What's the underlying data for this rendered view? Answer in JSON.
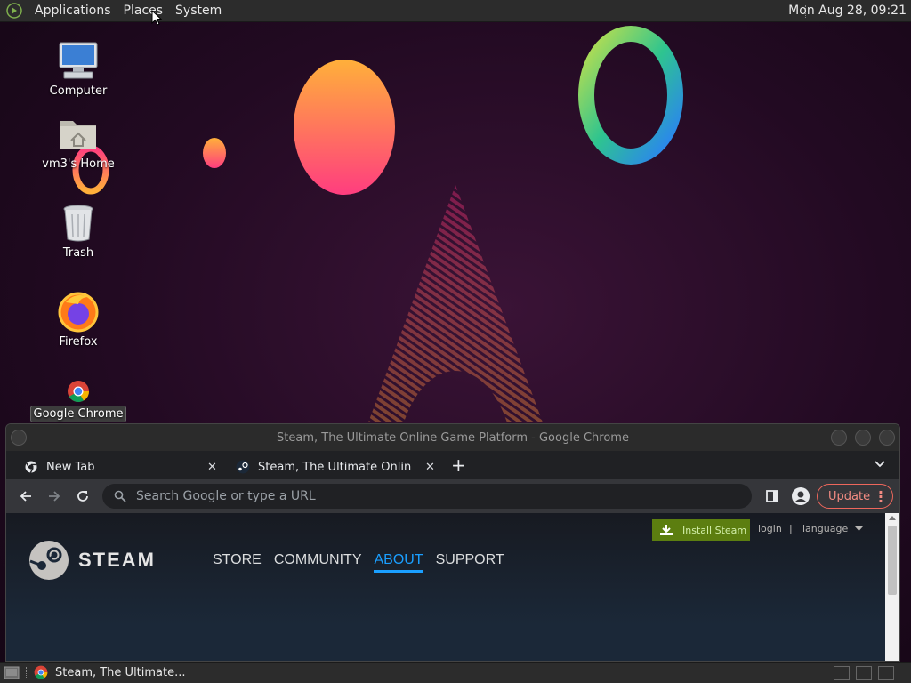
{
  "top_panel": {
    "menu": [
      "Applications",
      "Places",
      "System"
    ],
    "clock": "Mon Aug 28, 09:21"
  },
  "desktop": {
    "icons": [
      {
        "label": "Computer",
        "icon": "computer-icon"
      },
      {
        "label": "vm3's Home",
        "icon": "home-folder-icon"
      },
      {
        "label": "Trash",
        "icon": "trash-icon"
      },
      {
        "label": "Firefox",
        "icon": "firefox-icon"
      },
      {
        "label": "Google Chrome",
        "icon": "chrome-icon"
      }
    ]
  },
  "chrome": {
    "window_title": "Steam, The Ultimate Online Game Platform - Google Chrome",
    "tabs": [
      {
        "title": "New Tab",
        "icon": "chrome-icon"
      },
      {
        "title": "Steam, The Ultimate Online Game Platform",
        "icon": "steam-icon"
      }
    ],
    "omnibox_placeholder": "Search Google or type a URL",
    "update_label": "Update"
  },
  "steam_page": {
    "install_label": "Install Steam",
    "login_label": "login",
    "separator": "|",
    "language_label": "language",
    "logo_text": "STEAM",
    "nav": [
      "STORE",
      "COMMUNITY",
      "ABOUT",
      "SUPPORT"
    ],
    "active_nav": "ABOUT"
  },
  "taskbar": {
    "task_title": "Steam, The Ultimate..."
  },
  "colors": {
    "panel": "#2c2c2c",
    "steam_green": "#5c7e10",
    "steam_blue": "#1a9fff",
    "wallpaper": "#220a22"
  }
}
